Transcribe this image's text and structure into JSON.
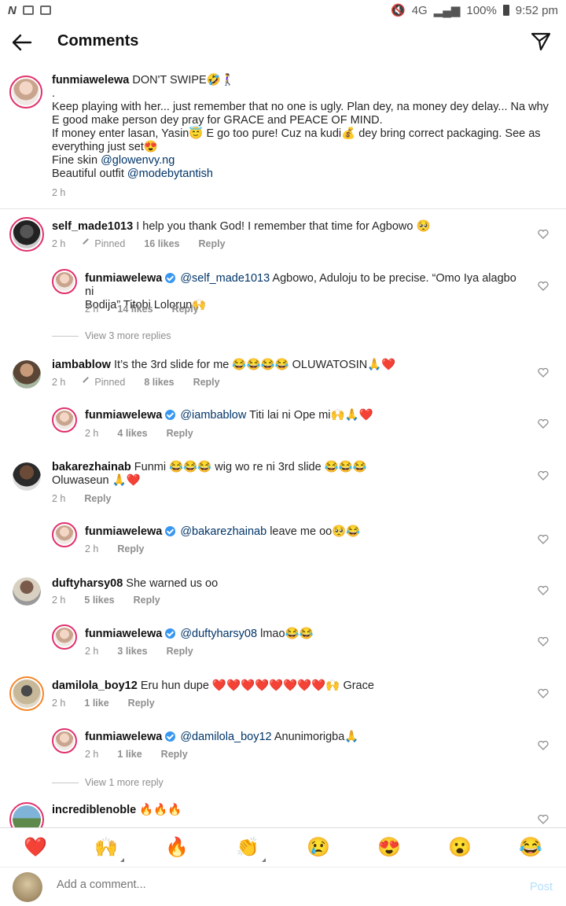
{
  "status": {
    "battery": "100%",
    "time": "9:52 pm",
    "network": "4G"
  },
  "header": {
    "title": "Comments"
  },
  "caption": {
    "user": "funmiawelewa",
    "lines": [
      "DON'T SWIPE🤣🚶‍♀️",
      ".",
      "Keep playing with her... just remember that no one is ugly. Plan dey, na money dey delay... Na why",
      "E good make person dey pray for GRACE and PEACE OF MIND.",
      "If money enter lasan, Yasin😇 E go too pure! Cuz na kudi💰 dey bring correct packaging. See as",
      "everything just set😍"
    ],
    "skin_prefix": "Fine skin ",
    "skin_mention": "@glowenvy.ng",
    "outfit_prefix": "Beautiful outfit ",
    "outfit_mention": "@modebytantish",
    "time": "2 h"
  },
  "comments": [
    {
      "user": "self_made1013",
      "text": " I help you thank God! I remember that time for Agbowo 🥺",
      "time": "2 h",
      "pinned": "Pinned",
      "likes": "16 likes",
      "reply": "Reply"
    },
    {
      "user": "funmiawelewa",
      "mention": "@self_made1013",
      "text": " Agbowo, Aduloju to be precise. “Omo Iya alagbo ni",
      "text2": "Bodija” Titobi Lolorun🙌",
      "time": "2 h",
      "likes": "14 likes",
      "reply": "Reply"
    },
    {
      "view_more": "View 3 more replies"
    },
    {
      "user": "iambablow",
      "text": " It’s the 3rd slide for me 😂😂😂😂 OLUWATOSIN🙏❤️",
      "time": "2 h",
      "pinned": "Pinned",
      "likes": "8 likes",
      "reply": "Reply"
    },
    {
      "user": "funmiawelewa",
      "mention": "@iambablow",
      "text": " Titi lai ni Ope mi🙌🙏❤️",
      "time": "2 h",
      "likes": "4 likes",
      "reply": "Reply"
    },
    {
      "user": "bakarezhainab",
      "text": " Funmi 😂😂😂 wig wo re ni 3rd slide 😂😂😂",
      "text2": "Oluwaseun 🙏❤️",
      "time": "2 h",
      "reply": "Reply"
    },
    {
      "user": "funmiawelewa",
      "mention": "@bakarezhainab",
      "text": " leave me oo🥺😂",
      "time": "2 h",
      "reply": "Reply"
    },
    {
      "user": "duftyharsy08",
      "text": " She warned us oo",
      "time": "2 h",
      "likes": "5 likes",
      "reply": "Reply"
    },
    {
      "user": "funmiawelewa",
      "mention": "@duftyharsy08",
      "text": " lmao😂😂",
      "time": "2 h",
      "likes": "3 likes",
      "reply": "Reply"
    },
    {
      "user": "damilola_boy12",
      "text": " Eru hun dupe ❤️❤️❤️❤️❤️❤️❤️❤️🙌 Grace",
      "time": "2 h",
      "likes": "1 like",
      "reply": "Reply"
    },
    {
      "user": "funmiawelewa",
      "mention": "@damilola_boy12",
      "text": " Anunimorigba🙏",
      "time": "2 h",
      "likes": "1 like",
      "reply": "Reply"
    },
    {
      "view_more": "View 1 more reply"
    },
    {
      "user": "incrediblenoble",
      "text": " 🔥🔥🔥"
    }
  ],
  "emoji_bar": [
    "❤️",
    "🙌",
    "🔥",
    "👏",
    "😢",
    "😍",
    "😮",
    "😂"
  ],
  "input": {
    "placeholder": "Add a comment...",
    "post_label": "Post"
  }
}
